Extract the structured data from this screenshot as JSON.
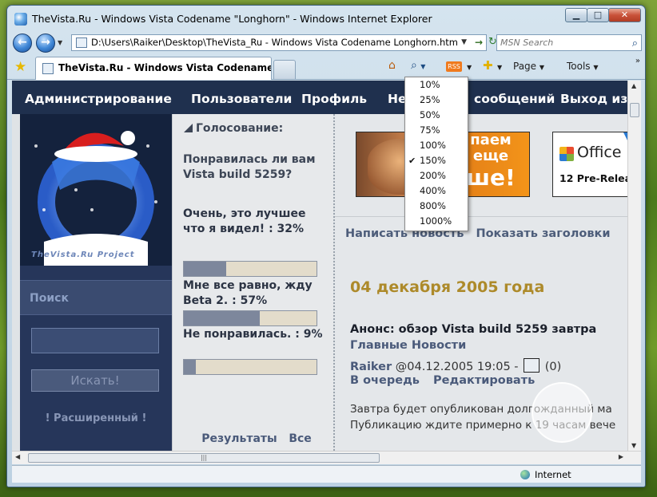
{
  "window": {
    "title": "TheVista.Ru - Windows Vista Codename \"Longhorn\" - Windows Internet Explorer",
    "min_glyph": "▁",
    "max_glyph": "□",
    "close_glyph": "✕"
  },
  "address_bar": {
    "back_glyph": "←",
    "forward_glyph": "→",
    "url": "D:\\Users\\Raiker\\Desktop\\TheVista_Ru - Windows Vista Codename Longhorn.htm",
    "dropdown_glyph": "▼",
    "go_glyph": "→",
    "refresh_glyph": "↻"
  },
  "search": {
    "placeholder": "MSN Search",
    "icon_glyph": "⌕"
  },
  "tabs": {
    "active_label": "TheVista.Ru - Windows Vista Codename \"Lon...",
    "fav_glyph": "★"
  },
  "command_bar": {
    "home_glyph": "⌂",
    "zoom_glyph": "⌕",
    "rss_label": "RSS",
    "print_glyph": "✚",
    "page_label": "Page",
    "tools_label": "Tools",
    "dd_glyph": "▼",
    "more_glyph": "»"
  },
  "zoom_menu": {
    "items": [
      "10%",
      "25%",
      "50%",
      "75%",
      "100%",
      "150%",
      "200%",
      "400%",
      "800%",
      "1000%"
    ],
    "selected_index": 5,
    "check_glyph": "✔"
  },
  "site_nav": {
    "items": [
      "Администрирование",
      "Пользователи",
      "Профиль",
      "Не",
      "сообщений",
      "Выход из"
    ]
  },
  "left_col": {
    "logo_caption": "TheVista.Ru Project",
    "search_heading": "Поиск",
    "search_button": "Искать!",
    "advanced_link": "! Расширенный !"
  },
  "poll": {
    "heading": "Голосование:",
    "question": "Понравилась ли вам Vista build 5259?",
    "options": [
      {
        "label": "Очень, это лучшее что я видел! : 32%",
        "percent": 32
      },
      {
        "label": "Мне все равно, жду Beta 2. : 57%",
        "percent": 57
      },
      {
        "label": "Не понравилась. : 9%",
        "percent": 9
      }
    ],
    "results_link": "Результаты",
    "all_polls_link": "Все опросы"
  },
  "banners": {
    "b1_text": "паем еще",
    "b1_big": "ше!",
    "office_text": "Office",
    "office_sub": "12 Pre-Relea"
  },
  "main": {
    "link_write": "Написать новость",
    "link_headlines": "Показать заголовки",
    "date": "04 декабря 2005 года",
    "news_title": "Анонс: обзор Vista build 5259 завтра",
    "news_category": "Главные Новости",
    "author": "Raiker",
    "timestamp": "@04.12.2005 19:05 -",
    "comments": "(0)",
    "action_queue": "В очередь",
    "action_edit": "Редактировать",
    "body_line1": "Завтра будет опубликован долгожданный ма",
    "body_line2": "Публикацию ждите примерно к 19 часам вече"
  },
  "scrollbars": {
    "up_glyph": "▲",
    "down_glyph": "▼",
    "left_glyph": "◀",
    "right_glyph": "▶",
    "grip_glyph": "|||"
  },
  "status": {
    "zone": "Internet"
  }
}
